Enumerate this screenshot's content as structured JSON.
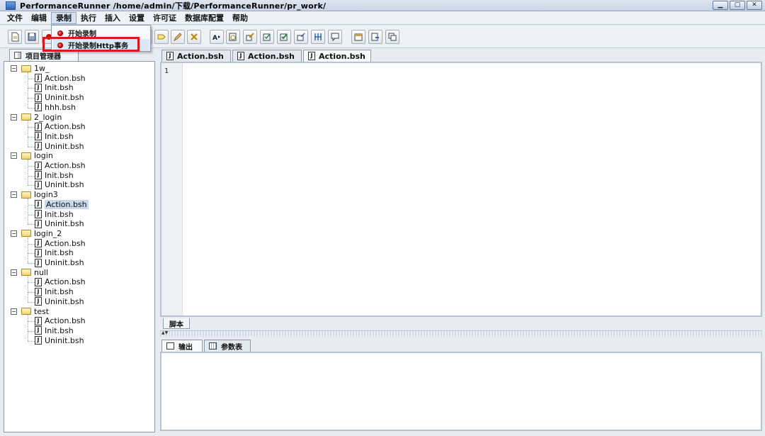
{
  "window": {
    "title": "PerformanceRunner  /home/admin/下载/PerformanceRunner/pr_work/"
  },
  "menu": {
    "items": [
      "文件",
      "编辑",
      "录制",
      "执行",
      "插入",
      "设置",
      "许可证",
      "数据库配置",
      "帮助"
    ],
    "active": "录制"
  },
  "dropdown": {
    "items": [
      "开始录制",
      "开始录制Http事务"
    ]
  },
  "project_panel": {
    "tab_label": "项目管理器",
    "tree": [
      {
        "name": "1w_",
        "files": [
          "Action.bsh",
          "Init.bsh",
          "Uninit.bsh",
          "hhh.bsh"
        ]
      },
      {
        "name": "2_login",
        "files": [
          "Action.bsh",
          "Init.bsh",
          "Uninit.bsh"
        ]
      },
      {
        "name": "login",
        "files": [
          "Action.bsh",
          "Init.bsh",
          "Uninit.bsh"
        ]
      },
      {
        "name": "login3",
        "files": [
          "Action.bsh",
          "Init.bsh",
          "Uninit.bsh"
        ]
      },
      {
        "name": "login_2",
        "files": [
          "Action.bsh",
          "Init.bsh",
          "Uninit.bsh"
        ]
      },
      {
        "name": "null",
        "files": [
          "Action.bsh",
          "Init.bsh",
          "Uninit.bsh"
        ]
      },
      {
        "name": "test",
        "files": [
          "Action.bsh",
          "Init.bsh",
          "Uninit.bsh"
        ]
      }
    ],
    "selected": "login3/Action.bsh"
  },
  "editor": {
    "tabs": [
      "Action.bsh",
      "Action.bsh",
      "Action.bsh"
    ],
    "active_tab": 2,
    "line_number": "1",
    "bottom_tab": "脚本"
  },
  "output": {
    "tabs": [
      "输出",
      "参数表"
    ],
    "active_tab": 0
  },
  "toolbar": {
    "icons": [
      "new-file-icon",
      "save-icon",
      "record-icon",
      "stop-icon",
      "checkpoint-icon",
      "tag-icon",
      "pen-icon",
      "tools-icon",
      "text-icon",
      "find-icon",
      "param-icon",
      "check-icon",
      "verify-icon",
      "insert-icon",
      "columns-icon",
      "comment-icon",
      "settings-icon",
      "export-icon",
      "window-icon"
    ]
  },
  "colors": {
    "highlight_box": "#e0161c",
    "selection": "#c8d9ee",
    "record_dot": "#d40000"
  }
}
